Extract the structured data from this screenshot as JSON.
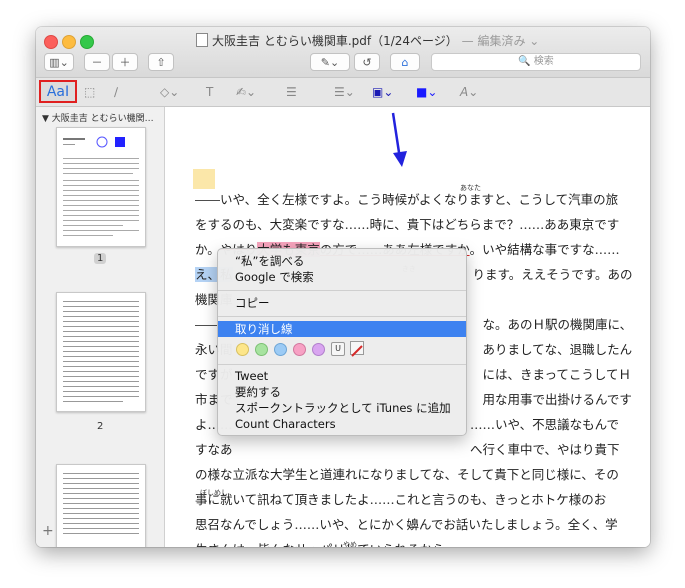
{
  "window": {
    "title": "大阪圭吉 とむらい機関車.pdf（1/24ページ）",
    "edited_label": "— 編集済み ⌄"
  },
  "toolbar": {
    "sidebar_toggle": "▥⌄",
    "zoom_out": "－",
    "zoom_in": "＋",
    "share": "⇧",
    "markup_toggle": "✎⌄",
    "rotate": "↺",
    "toolbox": "⌂",
    "search_placeholder": "🔍 検索"
  },
  "markup_toolbar": {
    "text_style": "AaI",
    "select_rect": "⬚",
    "sketch": "∕",
    "shapes": "◇⌄",
    "text_box": "T",
    "sign": "✍⌄",
    "note": "☰",
    "line_style": "☰⌄",
    "border_color": "▣⌄",
    "fill_color": "■⌄",
    "font": "A⌄",
    "colors": {
      "border": "#1a1ab4",
      "fill": "#1a1aff"
    }
  },
  "sidebar": {
    "header": "▼ 大阪圭吉 とむらい機関…",
    "pages": [
      {
        "label": "1"
      },
      {
        "label": "2"
      }
    ],
    "add_button": "+"
  },
  "document": {
    "lines": [
      "――いや、全く左様ですよ。こう時候がよくなりますと、こうして汽車の旅",
      "をするのも、大変楽ですな……時に、貴下はどちらまで？……ああ東京です",
      "か。やはり大学も東京の方で……ああ左様ですか。いや結構な事ですな……",
      "え、私　　　　　　　　　　　　　　　　　　　ります。ええそうです。あの",
      "機関庫",
      "――　　　　　　　　　　　　　　　　　　　　　な。あのＨ駅の機関庫に、",
      "永い間　　　　　　　　　　　　　　　　　　　　ありましてな、退職したん",
      "ですが　　　　　　　　　　　　　　　　　　　　には、きまってこうしてＨ",
      "市まで　　　　　　　　　　　　　　　　　　　　用な用事で出掛けるんです",
      "よ……　　　　　　　　　　　　　　　　　　　……いや、不思議なもんで",
      "すなあ　　　　　　　　　　　　　　　　　　　へ行く車中で、やはり貴下",
      "の様な立派な大学生と道連れになりましてな、そして貴下と同じ様に、その",
      "事に就いて訊ねて頂きましたよ……これと言うのも、きっとホトケ様のお",
      "思召なんでしょう……いや、とにかく嬶んでお話いたしましょう。全く、学",
      "生さんは、皆んなサッパリしていられるから……。"
    ],
    "ruby": {
      "anata": "あなた",
      "kiki": "きき",
      "boshimeshi": "ぼしめし",
      "yame": "やめ"
    }
  },
  "context_menu": {
    "items": [
      "“私”を調べる",
      "Google で検索",
      "コピー",
      "取り消し線",
      "Tweet",
      "要約する",
      "スポークントラックとして iTunes に追加",
      "Count Characters"
    ],
    "selected_index": 3,
    "swatches": [
      "#fde68a",
      "#a7e3a0",
      "#9ccbf5",
      "#f7a1c4",
      "#d9a5f0"
    ],
    "underline_label": "U"
  },
  "annotation": {
    "arrow_color": "#2222dd",
    "highlight_box_color": "#e02020"
  }
}
